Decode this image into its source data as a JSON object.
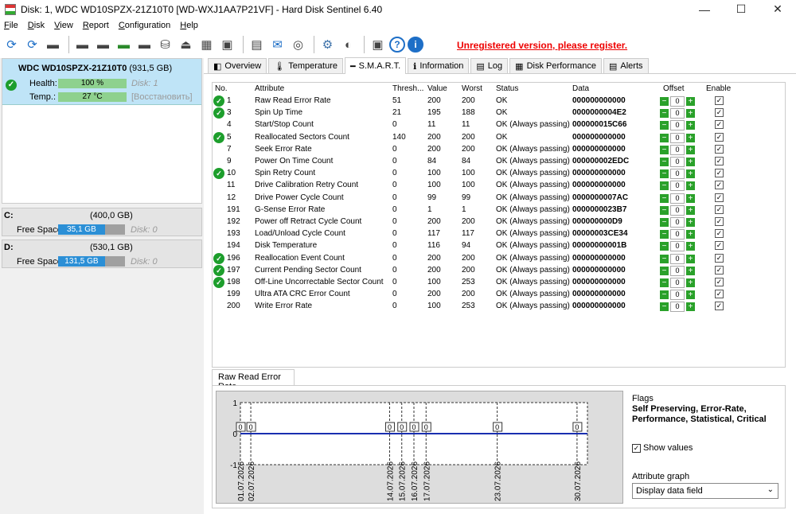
{
  "window": {
    "title": "Disk: 1, WDC WD10SPZX-21Z10T0 [WD-WXJ1AA7P21VF]  -  Hard Disk Sentinel 6.40",
    "min": "—",
    "max": "☐",
    "close": "✕"
  },
  "menu": [
    {
      "label": "File",
      "u": "F",
      "rest": "ile"
    },
    {
      "label": "Disk",
      "u": "D",
      "rest": "isk"
    },
    {
      "label": "View",
      "u": "V",
      "rest": "iew"
    },
    {
      "label": "Report",
      "u": "R",
      "rest": "eport"
    },
    {
      "label": "Configuration",
      "u": "C",
      "rest": "onfiguration"
    },
    {
      "label": "Help",
      "u": "H",
      "rest": "elp"
    }
  ],
  "toolbar_icons": [
    "refresh-icon",
    "refresh-warning-icon",
    "disk-list-icon",
    "disk-tool-icon",
    "disk-schedule-icon",
    "disk-check-icon",
    "disk-search-icon",
    "disk-save-icon",
    "disk-eject-icon",
    "hdd-stack-icon",
    "network-disk-icon",
    "report-icon",
    "email-icon",
    "network-icon",
    "settings-icon",
    "sound-icon",
    "screenshot-icon",
    "help-icon",
    "info-icon"
  ],
  "register_text": "Unregistered version, please register.",
  "disk": {
    "name": "WDC WD10SPZX-21Z10T0",
    "size": "(931,5 GB)",
    "health_label": "Health:",
    "health_value": "100 %",
    "health_pct": 100,
    "temp_label": "Temp.:",
    "temp_value": "27 °C",
    "disk_num": "Disk: 1",
    "restore": "[Восстановить]"
  },
  "drives": [
    {
      "letter": "C:",
      "capacity": "(400,0 GB)",
      "fs_label": "Free Space",
      "free": "35,1 GB",
      "free_pct": 0.09,
      "disk": "Disk: 0"
    },
    {
      "letter": "D:",
      "capacity": "(530,1 GB)",
      "fs_label": "Free Space",
      "free": "131,5 GB",
      "free_pct": 0.25,
      "disk": "Disk: 0"
    }
  ],
  "tabs": [
    {
      "label": "Overview",
      "icon": "overview-icon",
      "glyph": "◧"
    },
    {
      "label": "Temperature",
      "icon": "temperature-icon",
      "glyph": "🌡"
    },
    {
      "label": "S.M.A.R.T.",
      "icon": "smart-icon",
      "glyph": "━"
    },
    {
      "label": "Information",
      "icon": "information-icon",
      "glyph": "ℹ"
    },
    {
      "label": "Log",
      "icon": "log-icon",
      "glyph": "▤"
    },
    {
      "label": "Disk Performance",
      "icon": "performance-icon",
      "glyph": "▦"
    },
    {
      "label": "Alerts",
      "icon": "alerts-icon",
      "glyph": "▤"
    }
  ],
  "smart_headers": {
    "no": "No.",
    "attribute": "Attribute",
    "threshold": "Thresh...",
    "value": "Value",
    "worst": "Worst",
    "status": "Status",
    "data": "Data",
    "offset": "Offset",
    "enable": "Enable"
  },
  "smart_rows": [
    {
      "no": "1",
      "attr": "Raw Read Error Rate",
      "th": "51",
      "val": "200",
      "worst": "200",
      "status": "OK",
      "data": "000000000000",
      "ok": true
    },
    {
      "no": "3",
      "attr": "Spin Up Time",
      "th": "21",
      "val": "195",
      "worst": "188",
      "status": "OK",
      "data": "0000000004E2",
      "ok": true
    },
    {
      "no": "4",
      "attr": "Start/Stop Count",
      "th": "0",
      "val": "11",
      "worst": "11",
      "status": "OK (Always passing)",
      "data": "000000015C66",
      "ok": false
    },
    {
      "no": "5",
      "attr": "Reallocated Sectors Count",
      "th": "140",
      "val": "200",
      "worst": "200",
      "status": "OK",
      "data": "000000000000",
      "ok": true
    },
    {
      "no": "7",
      "attr": "Seek Error Rate",
      "th": "0",
      "val": "200",
      "worst": "200",
      "status": "OK (Always passing)",
      "data": "000000000000",
      "ok": false
    },
    {
      "no": "9",
      "attr": "Power On Time Count",
      "th": "0",
      "val": "84",
      "worst": "84",
      "status": "OK (Always passing)",
      "data": "000000002EDC",
      "ok": false
    },
    {
      "no": "10",
      "attr": "Spin Retry Count",
      "th": "0",
      "val": "100",
      "worst": "100",
      "status": "OK (Always passing)",
      "data": "000000000000",
      "ok": true
    },
    {
      "no": "11",
      "attr": "Drive Calibration Retry Count",
      "th": "0",
      "val": "100",
      "worst": "100",
      "status": "OK (Always passing)",
      "data": "000000000000",
      "ok": false
    },
    {
      "no": "12",
      "attr": "Drive Power Cycle Count",
      "th": "0",
      "val": "99",
      "worst": "99",
      "status": "OK (Always passing)",
      "data": "0000000007AC",
      "ok": false
    },
    {
      "no": "191",
      "attr": "G-Sense Error Rate",
      "th": "0",
      "val": "1",
      "worst": "1",
      "status": "OK (Always passing)",
      "data": "0000000023B7",
      "ok": false
    },
    {
      "no": "192",
      "attr": "Power off Retract Cycle Count",
      "th": "0",
      "val": "200",
      "worst": "200",
      "status": "OK (Always passing)",
      "data": "000000000D9",
      "ok": false
    },
    {
      "no": "193",
      "attr": "Load/Unload Cycle Count",
      "th": "0",
      "val": "117",
      "worst": "117",
      "status": "OK (Always passing)",
      "data": "00000003CE34",
      "ok": false
    },
    {
      "no": "194",
      "attr": "Disk Temperature",
      "th": "0",
      "val": "116",
      "worst": "94",
      "status": "OK (Always passing)",
      "data": "00000000001B",
      "ok": false
    },
    {
      "no": "196",
      "attr": "Reallocation Event Count",
      "th": "0",
      "val": "200",
      "worst": "200",
      "status": "OK (Always passing)",
      "data": "000000000000",
      "ok": true
    },
    {
      "no": "197",
      "attr": "Current Pending Sector Count",
      "th": "0",
      "val": "200",
      "worst": "200",
      "status": "OK (Always passing)",
      "data": "000000000000",
      "ok": true
    },
    {
      "no": "198",
      "attr": "Off-Line Uncorrectable Sector Count",
      "th": "0",
      "val": "100",
      "worst": "253",
      "status": "OK (Always passing)",
      "data": "000000000000",
      "ok": true
    },
    {
      "no": "199",
      "attr": "Ultra ATA CRC Error Count",
      "th": "0",
      "val": "200",
      "worst": "200",
      "status": "OK (Always passing)",
      "data": "000000000000",
      "ok": false
    },
    {
      "no": "200",
      "attr": "Write Error Rate",
      "th": "0",
      "val": "100",
      "worst": "253",
      "status": "OK (Always passing)",
      "data": "000000000000",
      "ok": false
    }
  ],
  "offset_value": "0",
  "graph": {
    "tab_label": "Raw Read Error Rate",
    "flags_label": "Flags",
    "flags": "Self Preserving, Error-Rate, Performance, Statistical, Critical",
    "show_values": "Show values",
    "attr_graph_label": "Attribute graph",
    "attr_graph_value": "Display data field"
  },
  "chart_data": {
    "type": "line",
    "x": [
      "01.07.2026",
      "02.07.2026",
      "14.07.2026",
      "15.07.2026",
      "16.07.2026",
      "17.07.2026",
      "23.07.2026",
      "30.07.2026"
    ],
    "series": [
      {
        "values": [
          0,
          0,
          0,
          0,
          0,
          0,
          0,
          0
        ]
      }
    ],
    "ylim": [
      -1,
      1
    ],
    "yticks": [
      "1",
      "0",
      "-1"
    ],
    "line_color": "#1a2fb0"
  }
}
